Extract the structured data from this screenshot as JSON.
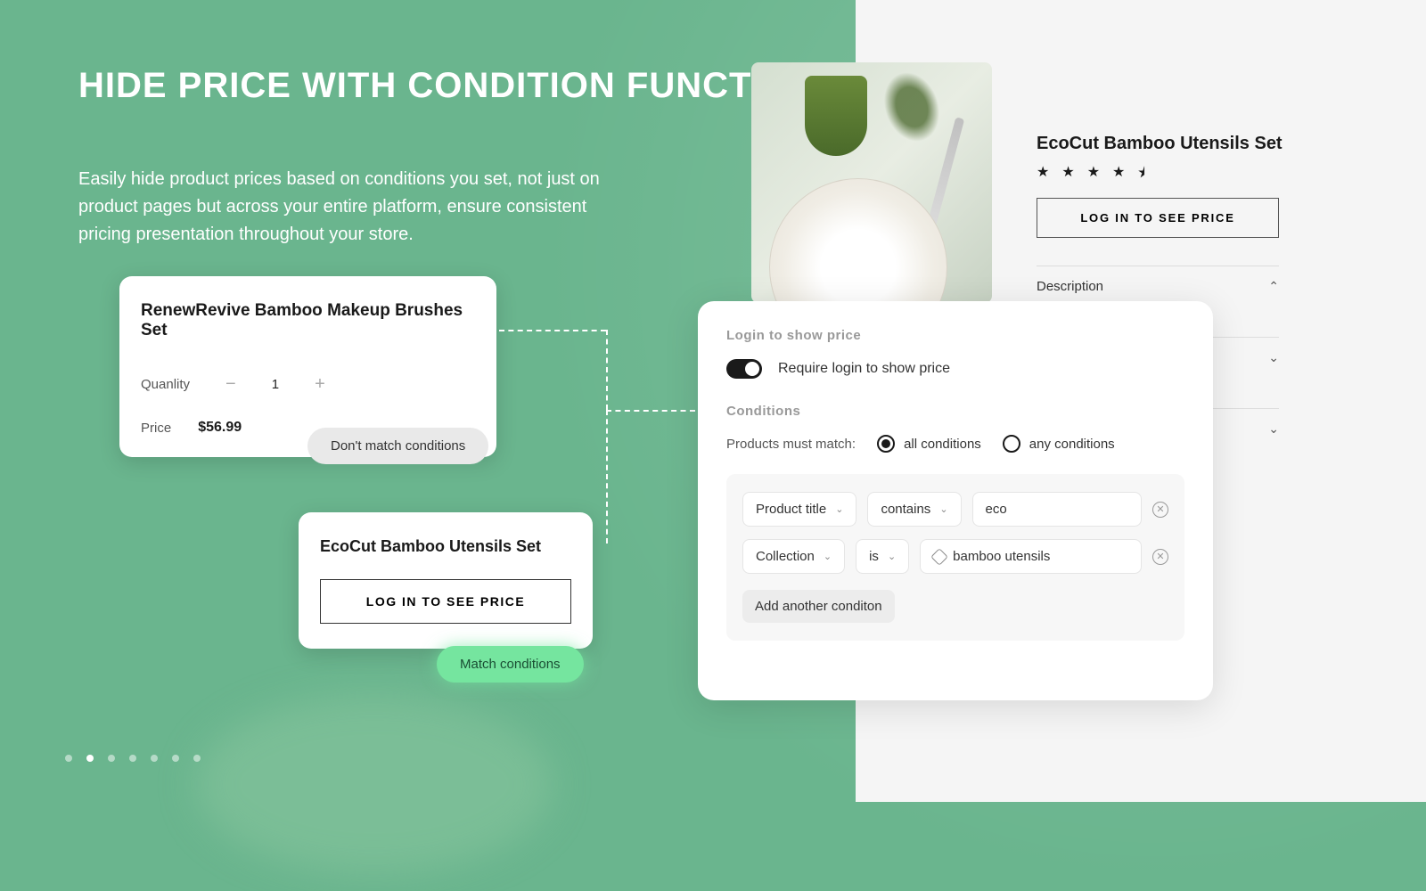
{
  "hero": {
    "title": "HIDE PRICE WITH CONDITION FUNCTIONALITY",
    "desc": "Easily hide product prices based on conditions you set, not just on product pages but across your entire platform, ensure consistent pricing presentation throughout your store."
  },
  "card1": {
    "title": "RenewRevive Bamboo Makeup Brushes Set",
    "qty_label": "Quanlity",
    "qty_value": "1",
    "price_label": "Price",
    "price_value": "$56.99",
    "badge": "Don't match conditions"
  },
  "card2": {
    "title": "EcoCut Bamboo Utensils Set",
    "button": "LOG IN TO SEE PRICE",
    "badge": "Match conditions"
  },
  "product": {
    "title": "EcoCut Bamboo Utensils Set",
    "login_button": "LOG IN TO SEE PRICE",
    "accordion": {
      "desc": "Description"
    }
  },
  "config": {
    "section1": "Login to show price",
    "toggle_label": "Require login to show price",
    "section2": "Conditions",
    "match_label": "Products must match:",
    "radio_all": "all conditions",
    "radio_any": "any conditions",
    "rows": [
      {
        "field": "Product title",
        "op": "contains",
        "value": "eco"
      },
      {
        "field": "Collection",
        "op": "is",
        "value": "bamboo utensils"
      }
    ],
    "add": "Add another conditon"
  }
}
